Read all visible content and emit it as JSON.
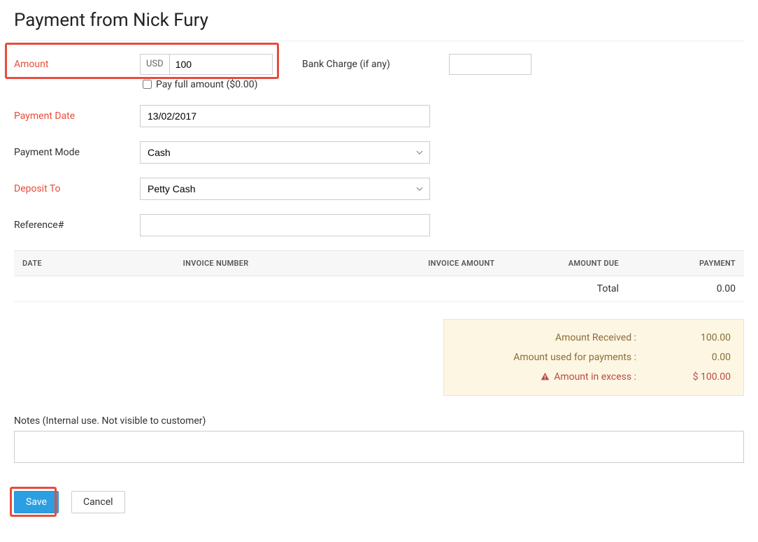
{
  "header": {
    "title": "Payment from Nick Fury"
  },
  "form": {
    "amount": {
      "label": "Amount",
      "currency": "USD",
      "value": "100"
    },
    "bank_charge": {
      "label": "Bank Charge (if any)",
      "value": ""
    },
    "pay_full_label": "Pay full amount ($0.00)",
    "payment_date": {
      "label": "Payment Date",
      "value": "13/02/2017"
    },
    "payment_mode": {
      "label": "Payment Mode",
      "value": "Cash"
    },
    "deposit_to": {
      "label": "Deposit To",
      "value": "Petty Cash"
    },
    "reference": {
      "label": "Reference#",
      "value": ""
    }
  },
  "table": {
    "headers": {
      "date": "DATE",
      "invoice_number": "INVOICE NUMBER",
      "invoice_amount": "INVOICE AMOUNT",
      "amount_due": "AMOUNT DUE",
      "payment": "PAYMENT"
    },
    "total_label": "Total",
    "total_value": "0.00"
  },
  "summary": {
    "received_label": "Amount Received :",
    "received_value": "100.00",
    "used_label": "Amount used for payments :",
    "used_value": "0.00",
    "excess_label": "Amount in excess :",
    "excess_value": "$ 100.00"
  },
  "notes": {
    "label": "Notes (Internal use. Not visible to customer)",
    "value": ""
  },
  "actions": {
    "save": "Save",
    "cancel": "Cancel"
  }
}
